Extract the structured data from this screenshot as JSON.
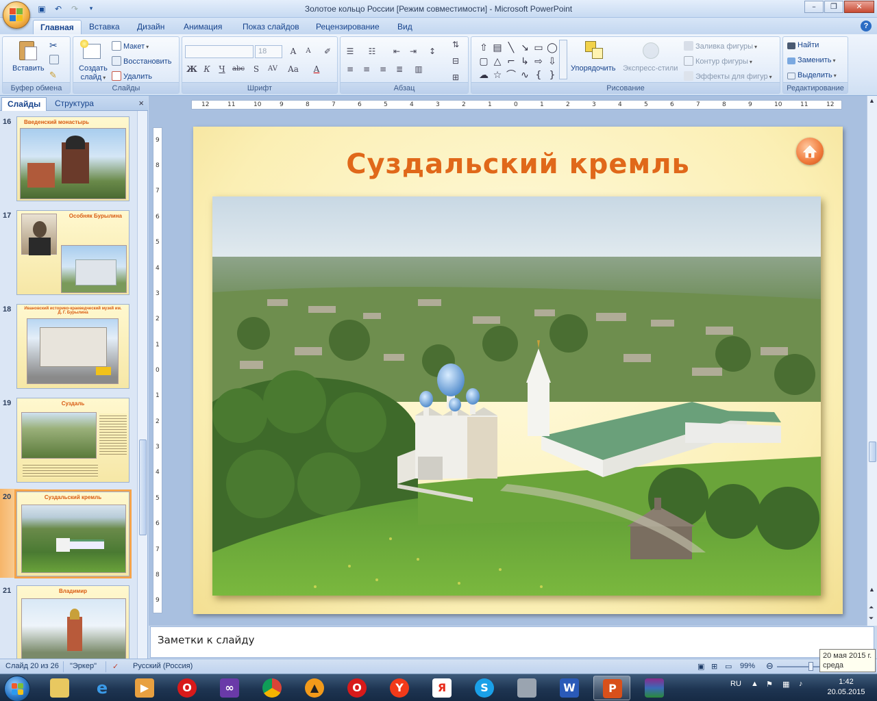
{
  "window": {
    "title": "Золотое кольцо России [Режим совместимости] - Microsoft PowerPoint",
    "controls": {
      "minimize": "–",
      "maximize": "❐",
      "close": "✕"
    }
  },
  "quick_access": [
    "save-icon",
    "undo-icon",
    "redo-icon",
    "customize-icon"
  ],
  "ribbon_tabs": [
    "Главная",
    "Вставка",
    "Дизайн",
    "Анимация",
    "Показ слайдов",
    "Рецензирование",
    "Вид"
  ],
  "ribbon": {
    "clipboard": {
      "label": "Буфер обмена",
      "paste": "Вставить"
    },
    "slides": {
      "label": "Слайды",
      "new_slide_1": "Создать",
      "new_slide_2": "слайд",
      "layout": "Макет",
      "reset": "Восстановить",
      "delete": "Удалить"
    },
    "font": {
      "label": "Шрифт",
      "font_size": "18"
    },
    "paragraph": {
      "label": "Абзац"
    },
    "drawing": {
      "label": "Рисование",
      "arrange": "Упорядочить",
      "quick_styles": "Экспресс-стили",
      "shape_fill": "Заливка фигуры",
      "shape_outline": "Контур фигуры",
      "shape_effects": "Эффекты для фигур"
    },
    "editing": {
      "label": "Редактирование",
      "find": "Найти",
      "replace": "Заменить",
      "select": "Выделить"
    }
  },
  "pane": {
    "tab_slides": "Слайды",
    "tab_outline": "Структура",
    "close": "×"
  },
  "thumbnails": [
    {
      "num": "16",
      "title": "Введенский монастырь"
    },
    {
      "num": "17",
      "title": "Особняк Бурылина"
    },
    {
      "num": "18",
      "title": "Ивановский историко-краеведческий музей им. Д. Г. Бурылина"
    },
    {
      "num": "19",
      "title": "Суздаль"
    },
    {
      "num": "20",
      "title": "Суздальский кремль"
    },
    {
      "num": "21",
      "title": "Владимир"
    }
  ],
  "ruler": {
    "h": [
      "12",
      "11",
      "10",
      "9",
      "8",
      "7",
      "6",
      "5",
      "4",
      "3",
      "2",
      "1",
      "0",
      "1",
      "2",
      "3",
      "4",
      "5",
      "6",
      "7",
      "8",
      "9",
      "10",
      "11",
      "12"
    ],
    "v": [
      "9",
      "8",
      "7",
      "6",
      "5",
      "4",
      "3",
      "2",
      "1",
      "0",
      "1",
      "2",
      "3",
      "4",
      "5",
      "6",
      "7",
      "8",
      "9"
    ]
  },
  "slide": {
    "title": "Суздальский кремль"
  },
  "notes": {
    "placeholder": "Заметки к слайду"
  },
  "status": {
    "slide_info": "Слайд 20 из 26",
    "theme": "\"Эркер\"",
    "language": "Русский (Россия)",
    "zoom": "99%"
  },
  "tooltip": {
    "line1": "20 мая 2015 г.",
    "line2": "среда"
  },
  "taskbar": {
    "lang": "RU",
    "time": "1:42",
    "date": "20.05.2015",
    "apps": [
      "explorer-icon",
      "ie-icon",
      "media-player-icon",
      "opera-icon",
      "visual-studio-icon",
      "chrome-icon",
      "aimp-icon",
      "opera-icon",
      "yandex-browser-icon",
      "yandex-icon",
      "skype-icon",
      "scanner-icon",
      "word-icon",
      "powerpoint-icon",
      "winrar-icon"
    ]
  }
}
